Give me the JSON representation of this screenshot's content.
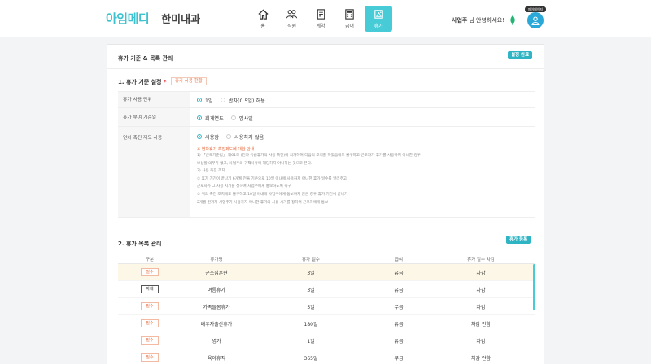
{
  "app": {
    "logo_main": "아임메디",
    "logo_sub": "한미내과"
  },
  "nav": [
    {
      "label": "홈",
      "icon": "home-icon",
      "active": false
    },
    {
      "label": "직원",
      "icon": "people-icon",
      "active": false
    },
    {
      "label": "계약",
      "icon": "document-icon",
      "active": false
    },
    {
      "label": "급여",
      "icon": "calculator-icon",
      "active": false
    },
    {
      "label": "휴가",
      "icon": "vacation-icon",
      "active": true
    }
  ],
  "user": {
    "name": "사업주",
    "greeting": "님 안녕하세요!",
    "badge": "마이페이지"
  },
  "card": {
    "title": "휴가 기준 & 목록 관리",
    "save_label": "설정 완료"
  },
  "section1": {
    "title": "1. 휴가 기준 설정",
    "required_mark": "*",
    "status_tag": "휴가 사용 현황",
    "rows": [
      {
        "label": "휴가 사용 단위",
        "options": [
          "1일",
          "반차(0.5일) 허용"
        ],
        "selected": 0
      },
      {
        "label": "휴가 부여 기준일",
        "options": [
          "회계연도",
          "입사일"
        ],
        "selected": 0
      },
      {
        "label": "연차 촉진 제도 사용",
        "options": [
          "사용함",
          "사용하지 않음"
        ],
        "selected": 0
      }
    ],
    "notice_title": "※ 연차휴가 촉진제도에 대한 안내",
    "notice_lines": [
      "1) 「근로기준법」 제61조 (연차 유급휴가의 사용 촉진)에 의거하여 다음의 조치를 하였음에도 불구하고 근로자가 휴가를 사용하지 아니한 경우",
      "보상할 의무가 없고, 사업주의 귀책사유에 해당하지 아니하는 것으로 본다.",
      "2) 사용 촉진 조치",
      "① 휴가 기간이 끝나기 6개월 전을 기준으로 10일 이내에 사용하지 아니한 휴가 일수를 알려주고,",
      "근로자가 그 사용 시기를 정하여 사업주에게 통보하도록 촉구",
      "② 위의 촉진 조치에도 불구하고 10일 이내에 사업주에게 통보하지 않은 경우 휴가 기간이 끝나기",
      "2개월 전까지 사업주가 사용하지 아니한 휴가의 사용 시기를 정하여 근로자에게 통보"
    ]
  },
  "section2": {
    "title": "2. 휴가 목록 관리",
    "register_label": "휴가 등록",
    "columns": [
      "구분",
      "휴가명",
      "휴가 일수",
      "급여",
      "휴가 일수 차감"
    ],
    "rows": [
      {
        "type": "필수",
        "name": "군소집훈련",
        "days": "3일",
        "pay": "유급",
        "deduct": "차감"
      },
      {
        "type": "자체",
        "name": "여름휴가",
        "days": "3일",
        "pay": "유급",
        "deduct": "차감"
      },
      {
        "type": "필수",
        "name": "가족돌봄휴가",
        "days": "5일",
        "pay": "무급",
        "deduct": "차감"
      },
      {
        "type": "필수",
        "name": "배우자출산휴가",
        "days": "180일",
        "pay": "유급",
        "deduct": "차감 안함"
      },
      {
        "type": "필수",
        "name": "병가",
        "days": "1일",
        "pay": "유급",
        "deduct": "차감"
      },
      {
        "type": "필수",
        "name": "육아휴직",
        "days": "365일",
        "pay": "무급",
        "deduct": "차감 안함"
      }
    ]
  }
}
